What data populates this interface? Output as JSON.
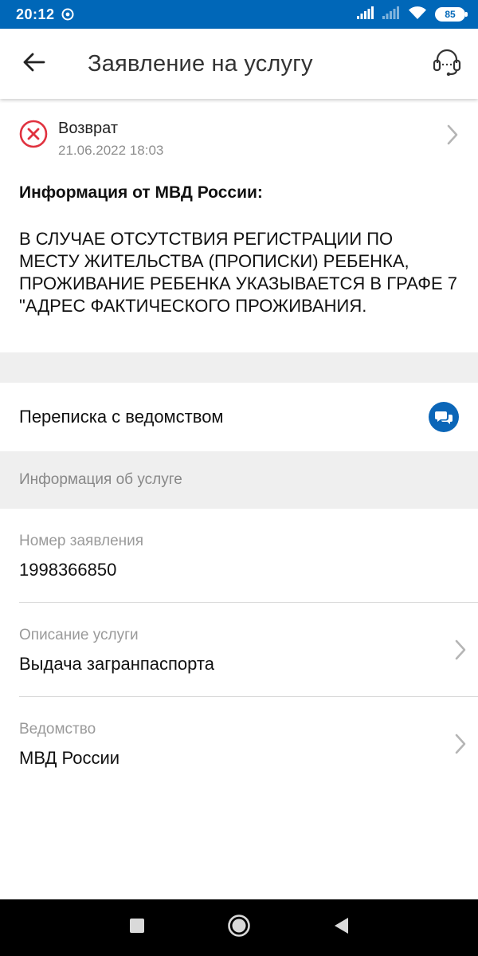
{
  "status_bar": {
    "time": "20:12",
    "battery": "85",
    "icons": [
      "notification-icon",
      "signal-icon",
      "signal-icon",
      "wifi-icon",
      "battery-icon"
    ]
  },
  "header": {
    "title": "Заявление на услугу",
    "icons": [
      "arrow-left-icon",
      "headset-icon"
    ]
  },
  "status": {
    "label": "Возврат",
    "date": "21.06.2022 18:03",
    "icon": "error-circle-icon",
    "color": "#e0323f"
  },
  "info": {
    "title": "Информация от МВД России:",
    "body": "В СЛУЧАЕ ОТСУТСТВИЯ РЕГИСТРАЦИИ ПО МЕСТУ ЖИТЕЛЬСТВА (ПРОПИСКИ) РЕБЕНКА, ПРОЖИВАНИЕ РЕБЕНКА УКАЗЫВАЕТСЯ В ГРАФЕ 7 \"АДРЕС ФАКТИЧЕСКОГО ПРОЖИВАНИЯ."
  },
  "chat": {
    "label": "Переписка с ведомством",
    "icon": "chat-icon",
    "color": "#0b66b8"
  },
  "section": {
    "title": "Информация об услуге"
  },
  "fields": [
    {
      "label": "Номер заявления",
      "value": "1998366850"
    },
    {
      "label": "Описание услуги",
      "value": "Выдача загранпаспорта"
    },
    {
      "label": "Ведомство",
      "value": "МВД России"
    }
  ],
  "colors": {
    "status_bar": "#0067b8",
    "accent": "#0b66b8",
    "error": "#e0323f"
  }
}
